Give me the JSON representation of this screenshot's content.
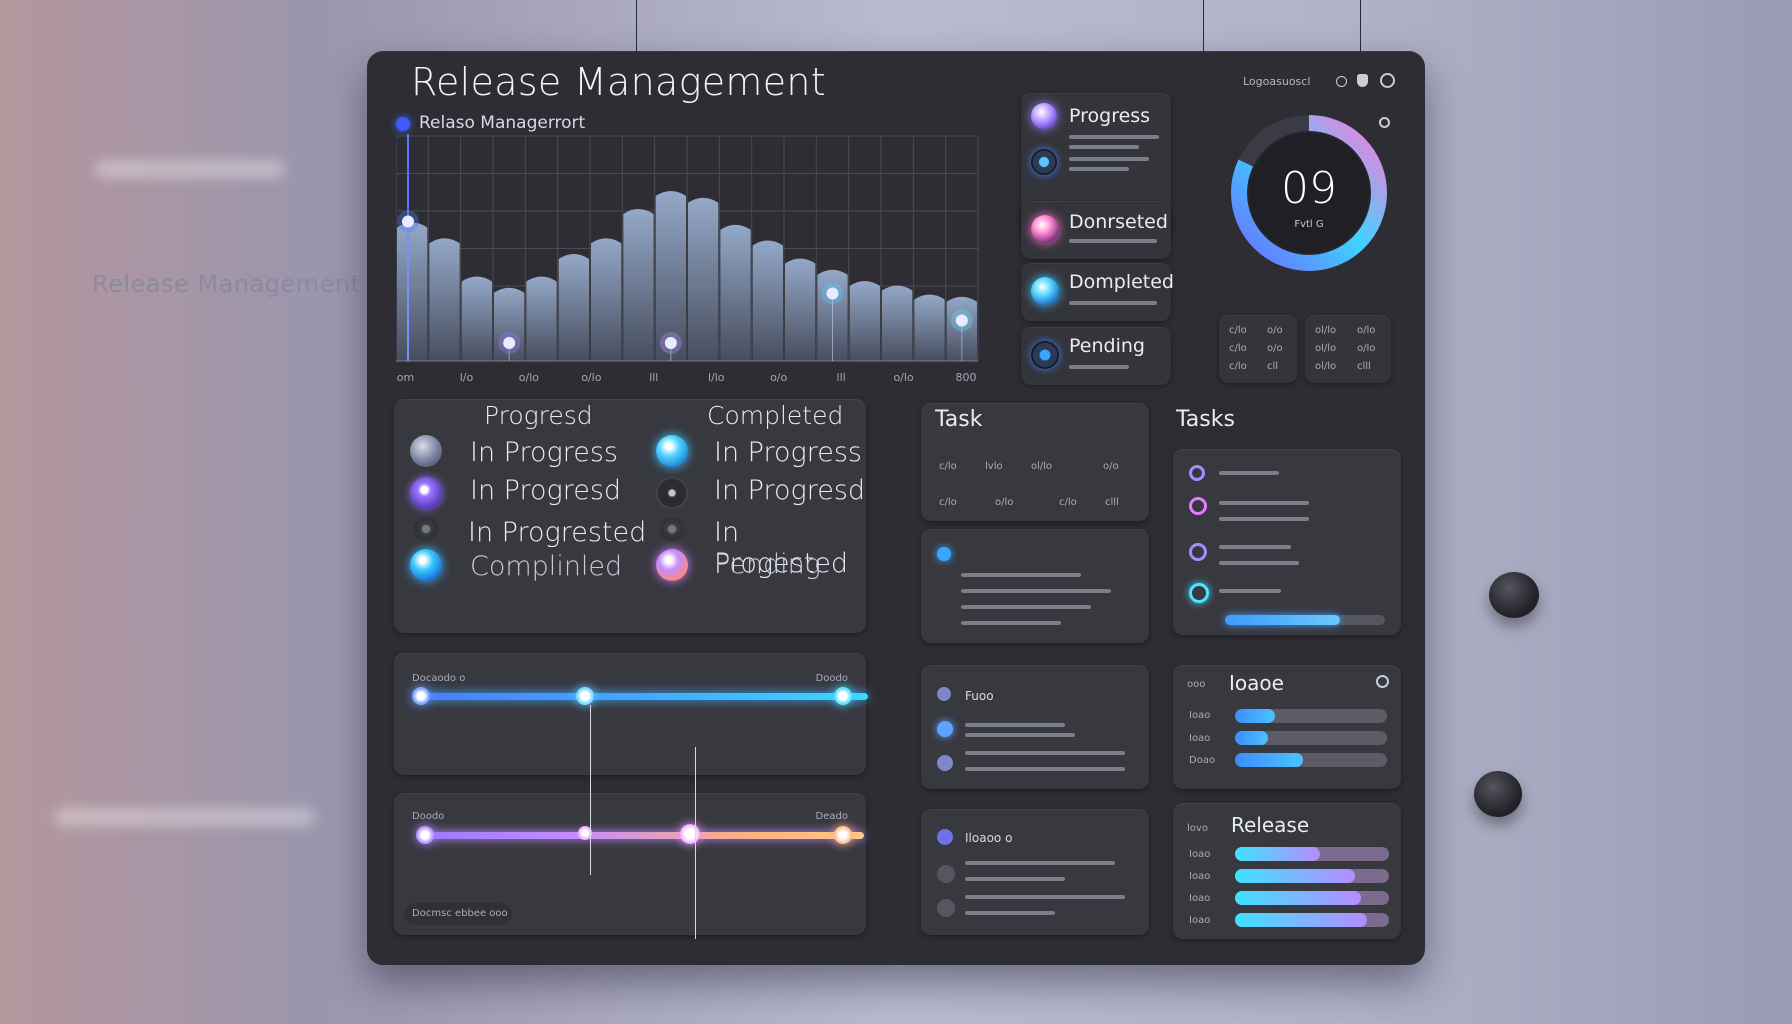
{
  "background": {
    "side_label": "Release Management"
  },
  "header": {
    "title": "Release Management",
    "subtitle": "Relaso Managerrort",
    "top_right_label": "Logoasuoscl"
  },
  "colors": {
    "accent_blue": "#3d9bff",
    "accent_cyan": "#39e0ff",
    "accent_purple": "#a46cff",
    "accent_pink": "#ff7ad9",
    "accent_orange": "#ffb67a"
  },
  "chart_data": {
    "type": "bar",
    "x_tick_labels": [
      "lom",
      "l/o",
      "o/lo",
      "o/lo",
      "lll",
      "l/lo",
      "o/o",
      "lll",
      "o/lo",
      "800"
    ],
    "values": [
      62,
      55,
      38,
      33,
      38,
      48,
      55,
      68,
      76,
      73,
      61,
      54,
      46,
      41,
      36,
      34,
      30,
      29
    ],
    "ylim": [
      0,
      100
    ],
    "markers": [
      {
        "index": 0,
        "y": 62,
        "color": "#4f7dff"
      },
      {
        "index": 3,
        "y": 8,
        "color": "#9a78ff"
      },
      {
        "index": 8,
        "y": 8,
        "color": "#c08cff"
      },
      {
        "index": 13,
        "y": 30,
        "color": "#5fc8ff"
      },
      {
        "index": 17,
        "y": 18,
        "color": "#6ad8ff"
      }
    ],
    "grid": true
  },
  "status_cards": [
    {
      "label": "Progress",
      "orb": "purple"
    },
    {
      "label": "",
      "orb": "blue"
    },
    {
      "label": "Donrseted",
      "orb": "pink"
    },
    {
      "label": "Dompleted",
      "orb": "cyan"
    },
    {
      "label": "Pending",
      "orb": "blue-dark"
    }
  ],
  "gauge": {
    "value": "09",
    "caption": "Fvtl G",
    "progress_fraction": 0.82,
    "mini_grid": [
      [
        "c/lo",
        "o/o",
        "ol/lo",
        "o/lo"
      ],
      [
        "c/lo",
        "o/o",
        "ol/lo",
        "o/lo"
      ],
      [
        "c/lo",
        "cll",
        "ol/lo",
        "clll"
      ]
    ]
  },
  "legend_panel": {
    "col1_header": "Progresd",
    "col2_header": "Completed",
    "col1": [
      {
        "label": "In Progress",
        "icon": "gray"
      },
      {
        "label": "In Progresd",
        "icon": "purple"
      },
      {
        "label": "In Progrested",
        "icon": "dark"
      },
      {
        "label": "Complinled",
        "icon": "cyan"
      }
    ],
    "col2": [
      {
        "label": "In Progress",
        "icon": "cyan"
      },
      {
        "label": "In Progresd",
        "icon": "dark"
      },
      {
        "label": "In Progested",
        "icon": "dark"
      },
      {
        "label": "Pending",
        "icon": "pink-orange"
      }
    ]
  },
  "timeline_1": {
    "left_label": "Docaodo o",
    "right_label": "Doodo"
  },
  "timeline_2": {
    "left_label": "Doodo",
    "right_label": "Deado",
    "footer_label": "Docmsc ebbee ooo"
  },
  "task_panel_1": {
    "heading": "Task",
    "cells": [
      "c/lo",
      "lvlo",
      "ol/lo",
      "o/o",
      "c/lo",
      "o/lo",
      "c/lo",
      "clll"
    ]
  },
  "tasks_panel_2": {
    "heading": "Tasks",
    "items": [
      {
        "icon": "purple"
      },
      {
        "icon": "pink"
      },
      {
        "icon": "purple"
      },
      {
        "icon": "cyan"
      }
    ],
    "slider_fraction": 0.72
  },
  "mini_list_1": {
    "label": "Fuoo"
  },
  "mini_list_2": {
    "label": "Iloaoo o"
  },
  "release_bars_1": {
    "heading": "Ioaoe",
    "prefix": "ooo",
    "rows": [
      {
        "label": "Ioao",
        "value": 0.26
      },
      {
        "label": "Ioao",
        "value": 0.22
      },
      {
        "label": "Doao",
        "value": 0.45
      }
    ]
  },
  "release_bars_2": {
    "heading": "Release",
    "prefix": "lovo",
    "rows": [
      {
        "label": "Ioao",
        "value": 0.55
      },
      {
        "label": "Ioao",
        "value": 0.78
      },
      {
        "label": "Ioao",
        "value": 0.82
      },
      {
        "label": "Ioao",
        "value": 0.86
      }
    ]
  }
}
